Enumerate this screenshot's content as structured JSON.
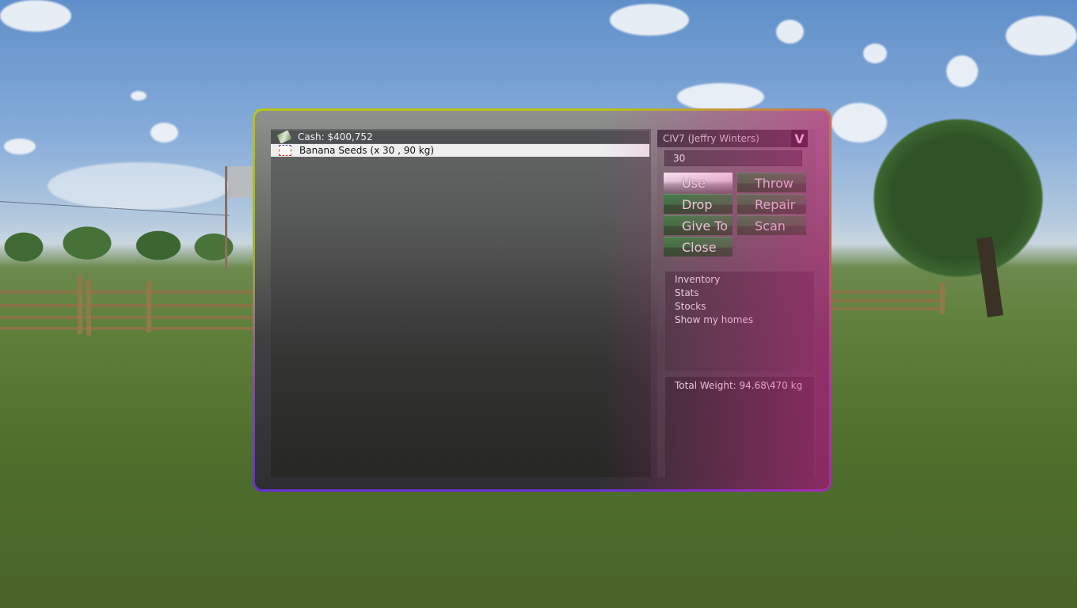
{
  "scene": "outdoor farm with fence, water tower and trees",
  "inventory": {
    "items": [
      {
        "icon": "money-icon",
        "label": "Cash: $400,752",
        "selected": false
      },
      {
        "icon": "seed-bag-icon",
        "label": "Banana Seeds (x 30 , 90 kg)",
        "selected": true
      }
    ]
  },
  "player_select": {
    "value": "CIV7 (Jeffry Winters)",
    "toggle_glyph": "V"
  },
  "quantity_input": {
    "value": "30"
  },
  "actions": {
    "use": "Use",
    "throw": "Throw",
    "drop": "Drop",
    "repair": "Repair",
    "give_to": "Give To",
    "scan": "Scan",
    "close": "Close"
  },
  "menu": {
    "items": [
      "Inventory",
      "Stats",
      "Stocks",
      "Show my homes"
    ]
  },
  "weight": {
    "label": "Total Weight: 94.68\\470 kg"
  },
  "colors": {
    "button_green": "#2a7a36",
    "frame_top": "#b9c418",
    "frame_bottom": "#6a2fd6",
    "frame_right_bottom": "#d6288c"
  }
}
